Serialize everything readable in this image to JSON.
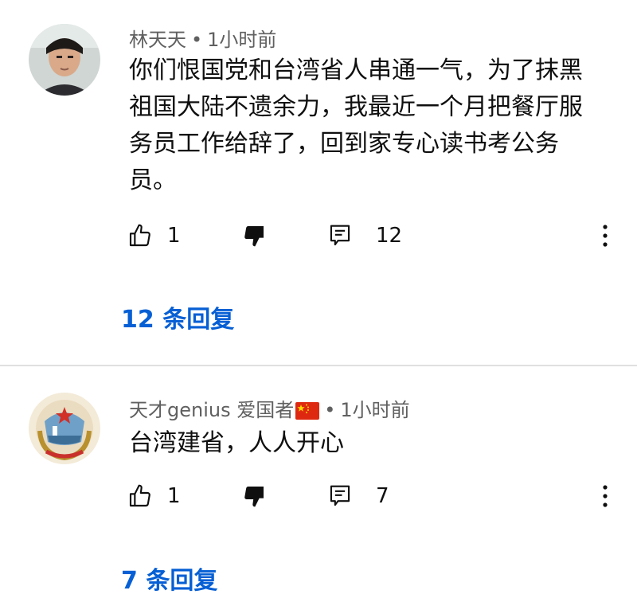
{
  "comments": [
    {
      "author": "林天天",
      "time": "1小时前",
      "text": "你们恨国党和台湾省人串通一气，为了抹黑\n祖国大陆不遗余力，我最近一个月把餐厅服\n务员工作给辞了，回到家专心读书考公务\n员。",
      "likes": "1",
      "replies": "12",
      "replies_label": "12 条回复"
    },
    {
      "author": "天才genius 爱国者",
      "time": "1小时前",
      "text": "台湾建省，人人开心",
      "likes": "1",
      "replies": "7",
      "replies_label": "7 条回复"
    }
  ],
  "meta_separator": "•",
  "icons": {
    "like": "thumbs-up-icon",
    "dislike": "thumbs-down-icon",
    "reply": "comment-icon",
    "more": "more-vertical-icon",
    "flag": "china-flag-icon"
  },
  "colors": {
    "link": "#065fd4",
    "meta": "#606060",
    "text": "#0f0f0f",
    "divider": "#e0e0e0"
  }
}
